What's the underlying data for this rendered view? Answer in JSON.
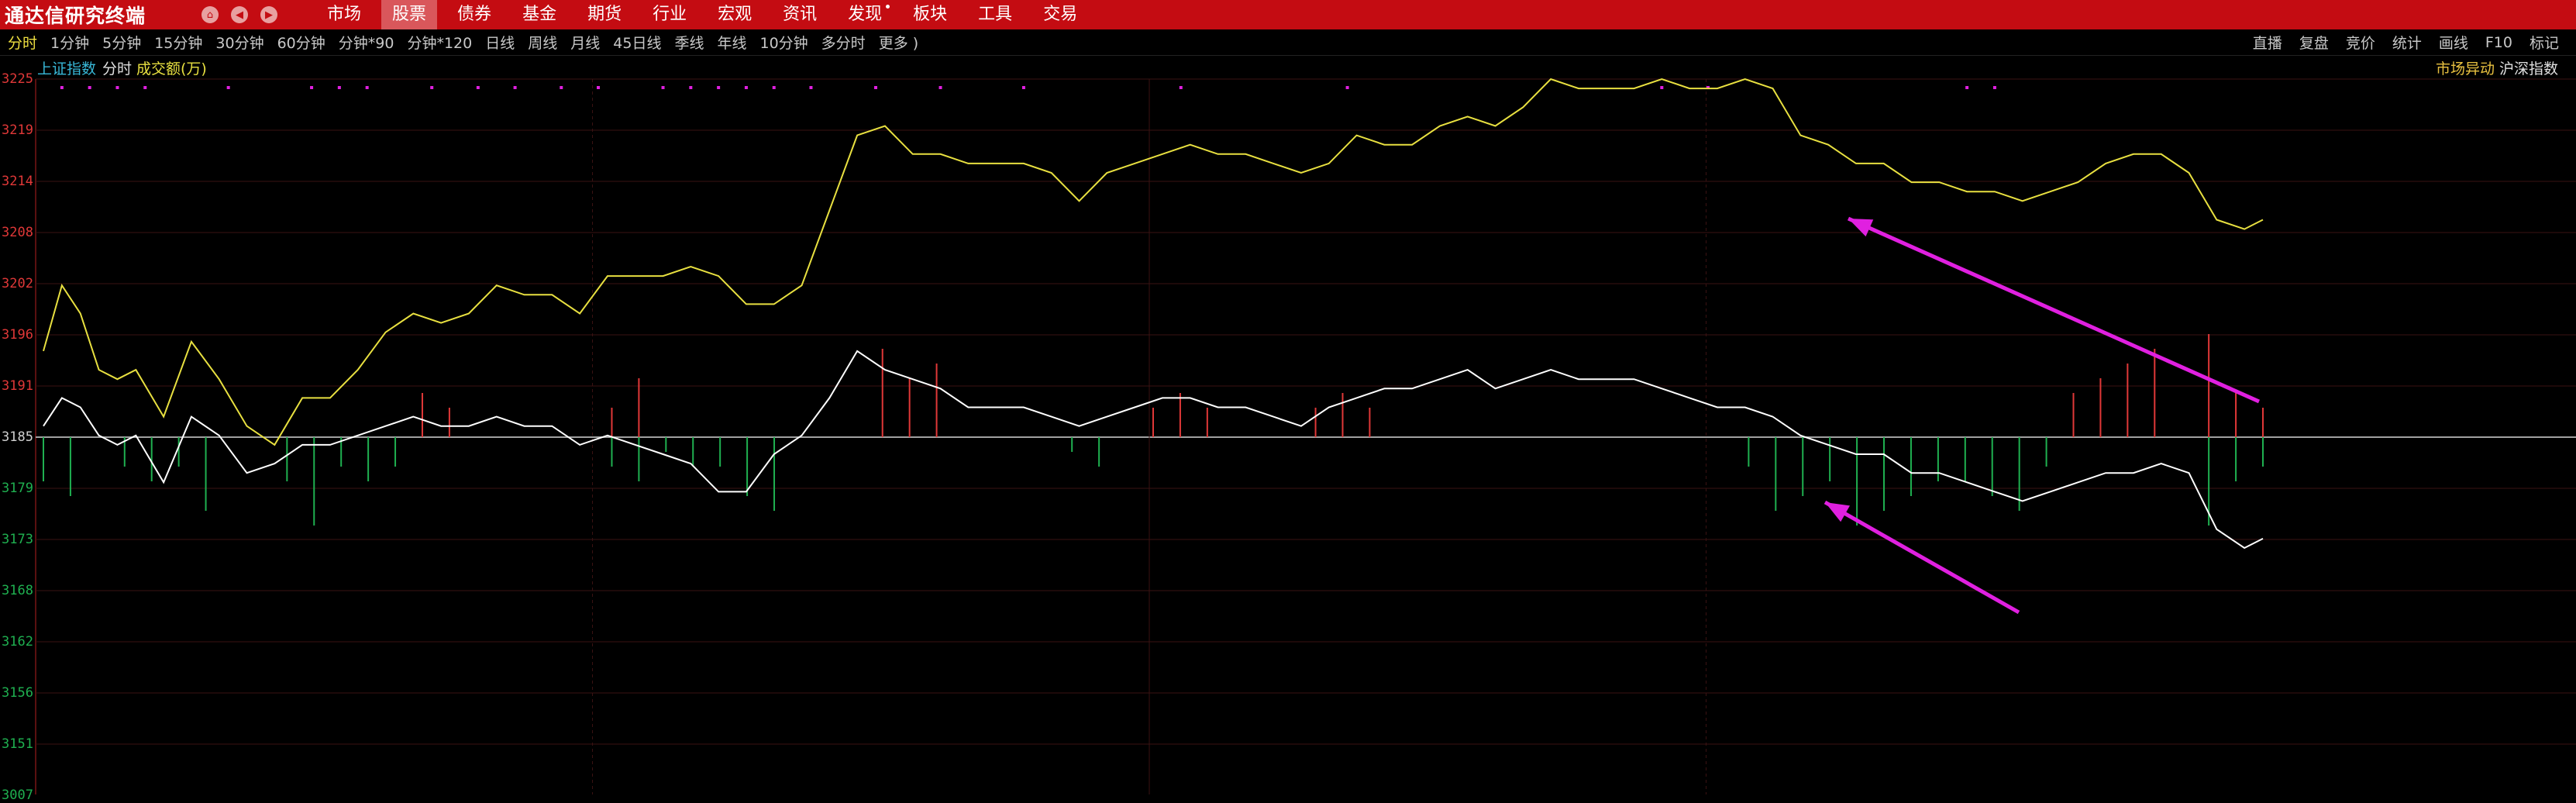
{
  "app": {
    "title": "通达信研究终端"
  },
  "nav": {
    "home": "⌂",
    "back": "◀",
    "forward": "▶"
  },
  "menu": [
    {
      "label": "市场",
      "active": false
    },
    {
      "label": "股票",
      "active": true
    },
    {
      "label": "债券",
      "active": false
    },
    {
      "label": "基金",
      "active": false
    },
    {
      "label": "期货",
      "active": false
    },
    {
      "label": "行业",
      "active": false
    },
    {
      "label": "宏观",
      "active": false
    },
    {
      "label": "资讯",
      "active": false
    },
    {
      "label": "发现",
      "active": false,
      "badge": true
    },
    {
      "label": "板块",
      "active": false
    },
    {
      "label": "工具",
      "active": false
    },
    {
      "label": "交易",
      "active": false
    }
  ],
  "periods": [
    "分时",
    "1分钟",
    "5分钟",
    "15分钟",
    "30分钟",
    "60分钟",
    "分钟*90",
    "分钟*120",
    "日线",
    "周线",
    "月线",
    "45日线",
    "季线",
    "年线",
    "10分钟",
    "多分时",
    "更多 )"
  ],
  "active_period": "分时",
  "right_tools": [
    "直播",
    "复盘",
    "竞价",
    "统计",
    "画线",
    "F10",
    "标记"
  ],
  "labels": {
    "index": "上证指数",
    "mode": "分时",
    "volume": "成交额(万)",
    "market_alert": "市场异动",
    "hs_index": "沪深指数"
  },
  "colors": {
    "titlebar": "#c40c12",
    "active_menu": "#d9575b",
    "yellow_line": "#e8e040",
    "white_line": "#ffffff",
    "up": "#e03838",
    "down": "#1fb050",
    "arrow": "#e020e0",
    "index_label": "#38b8d8"
  },
  "chart_data": {
    "type": "line",
    "y_ticks_up": [
      "3225",
      "3219",
      "3214",
      "3208",
      "3202",
      "3196",
      "3191"
    ],
    "y_tick_mid": "3185",
    "y_ticks_down": [
      "3179",
      "3173",
      "3168",
      "3162",
      "3156",
      "3151",
      "3007"
    ],
    "ylim": [
      3145,
      3225
    ],
    "series": [
      {
        "color": "yellow",
        "x": [
          0,
          2,
          4,
          6,
          8,
          10,
          13,
          16,
          19,
          22,
          25,
          28,
          31,
          34,
          37,
          40,
          43,
          46,
          49,
          52,
          55,
          58,
          61,
          64,
          67,
          70,
          73,
          76,
          79,
          82,
          85,
          88,
          91,
          94,
          97,
          100,
          103,
          106,
          109,
          112,
          115,
          118,
          121,
          124,
          127,
          130,
          133,
          136,
          139,
          142,
          145,
          148,
          151,
          154,
          157,
          160,
          163,
          166,
          169,
          172,
          175,
          178,
          181,
          184,
          187,
          190,
          193,
          196,
          199,
          202,
          205,
          208,
          211,
          214,
          217,
          220,
          223,
          226,
          229,
          232,
          235,
          238,
          240
        ],
        "values": [
          3196,
          3203,
          3200,
          3194,
          3193,
          3194,
          3189,
          3197,
          3193,
          3188,
          3186,
          3191,
          3191,
          3194,
          3198,
          3200,
          3199,
          3200,
          3203,
          3202,
          3202,
          3200,
          3204,
          3204,
          3204,
          3205,
          3204,
          3201,
          3201,
          3203,
          3211,
          3219,
          3220,
          3217,
          3217,
          3216,
          3216,
          3216,
          3215,
          3212,
          3215,
          3216,
          3217,
          3218,
          3217,
          3217,
          3216,
          3215,
          3216,
          3219,
          3218,
          3218,
          3220,
          3221,
          3220,
          3222,
          3225,
          3224,
          3224,
          3224,
          3225,
          3224,
          3224,
          3225,
          3224,
          3219,
          3218,
          3216,
          3216,
          3214,
          3214,
          3213,
          3213,
          3212,
          3213,
          3214,
          3216,
          3217,
          3217,
          3215,
          3210,
          3209,
          3210
        ]
      },
      {
        "color": "white",
        "x": [
          0,
          2,
          4,
          6,
          8,
          10,
          13,
          16,
          19,
          22,
          25,
          28,
          31,
          34,
          37,
          40,
          43,
          46,
          49,
          52,
          55,
          58,
          61,
          64,
          67,
          70,
          73,
          76,
          79,
          82,
          85,
          88,
          91,
          94,
          97,
          100,
          103,
          106,
          109,
          112,
          115,
          118,
          121,
          124,
          127,
          130,
          133,
          136,
          139,
          142,
          145,
          148,
          151,
          154,
          157,
          160,
          163,
          166,
          169,
          172,
          175,
          178,
          181,
          184,
          187,
          190,
          193,
          196,
          199,
          202,
          205,
          208,
          211,
          214,
          217,
          220,
          223,
          226,
          229,
          232,
          235,
          238,
          240
        ],
        "values": [
          3188,
          3191,
          3190,
          3187,
          3186,
          3187,
          3182,
          3189,
          3187,
          3183,
          3184,
          3186,
          3186,
          3187,
          3188,
          3189,
          3188,
          3188,
          3189,
          3188,
          3188,
          3186,
          3187,
          3186,
          3185,
          3184,
          3181,
          3181,
          3185,
          3187,
          3191,
          3196,
          3194,
          3193,
          3192,
          3190,
          3190,
          3190,
          3189,
          3188,
          3189,
          3190,
          3191,
          3191,
          3190,
          3190,
          3189,
          3188,
          3190,
          3191,
          3192,
          3192,
          3193,
          3194,
          3192,
          3193,
          3194,
          3193,
          3193,
          3193,
          3192,
          3191,
          3190,
          3190,
          3189,
          3187,
          3186,
          3185,
          3185,
          3183,
          3183,
          3182,
          3181,
          3180,
          3181,
          3182,
          3183,
          3183,
          3184,
          3183,
          3177,
          3175,
          3176
        ]
      }
    ],
    "volume_up": [
      0,
      0,
      0,
      0,
      0,
      0,
      0,
      0,
      0,
      0,
      0,
      0,
      0,
      0,
      3,
      2,
      0,
      0,
      0,
      0,
      0,
      2,
      4,
      0,
      0,
      0,
      0,
      0,
      0,
      0,
      0,
      6,
      4,
      5,
      0,
      0,
      0,
      0,
      0,
      0,
      0,
      2,
      3,
      2,
      0,
      0,
      0,
      2,
      3,
      2,
      0,
      0,
      0,
      0,
      0,
      0,
      0,
      0,
      0,
      0,
      0,
      0,
      0,
      0,
      0,
      0,
      0,
      0,
      0,
      0,
      0,
      0,
      0,
      0,
      0,
      3,
      4,
      5,
      6,
      0,
      7,
      3,
      2
    ],
    "volume_down": [
      3,
      4,
      0,
      2,
      3,
      2,
      5,
      0,
      0,
      3,
      6,
      2,
      3,
      2,
      0,
      0,
      0,
      0,
      0,
      0,
      0,
      2,
      3,
      1,
      2,
      2,
      4,
      5,
      0,
      0,
      0,
      0,
      0,
      0,
      0,
      0,
      0,
      0,
      1,
      2,
      0,
      0,
      0,
      0,
      0,
      0,
      0,
      0,
      0,
      0,
      0,
      0,
      0,
      0,
      0,
      0,
      0,
      0,
      0,
      0,
      0,
      0,
      0,
      2,
      5,
      4,
      3,
      6,
      5,
      4,
      3,
      3,
      4,
      5,
      2,
      0,
      0,
      0,
      0,
      0,
      6,
      3,
      2
    ]
  }
}
